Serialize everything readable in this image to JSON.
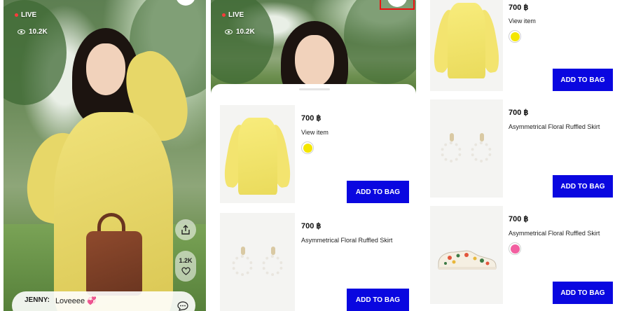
{
  "stream": {
    "live_label": "LIVE",
    "viewers": "10.2K",
    "likes": "1.2K",
    "comment": {
      "user": "JENNY:",
      "text": "Loveeee 💞"
    }
  },
  "colors": {
    "add_to_bag": "#0a07e0",
    "live_dot": "#ff3b3b",
    "highlight": "#ee1111"
  },
  "icons": {
    "viewers": "eye-icon",
    "share": "share-icon",
    "like": "heart-icon",
    "comment": "chat-bubble-icon"
  },
  "sheet_products": [
    {
      "price": "700 ฿",
      "name": "View item",
      "swatch": "#f4e600",
      "button": "ADD TO BAG"
    },
    {
      "price": "700 ฿",
      "name": "Asymmetrical Floral Ruffled Skirt",
      "swatch": "",
      "button": "ADD TO BAG"
    }
  ],
  "list_products": [
    {
      "price": "700 ฿",
      "name": "View item",
      "swatch": "#f4e600",
      "button": "ADD TO BAG"
    },
    {
      "price": "700 ฿",
      "name": "Asymmetrical Floral Ruffled Skirt",
      "swatch": "",
      "button": "ADD TO BAG"
    },
    {
      "price": "700 ฿",
      "name": "Asymmetrical Floral Ruffled Skirt",
      "swatch": "#f25fa0",
      "button": "ADD TO BAG"
    }
  ]
}
